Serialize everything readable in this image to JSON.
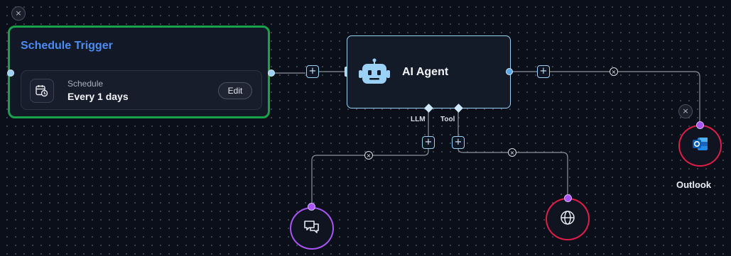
{
  "trigger": {
    "title": "Schedule Trigger",
    "schedule_label": "Schedule",
    "schedule_value": "Every 1 days",
    "edit_label": "Edit",
    "border_color": "#16a34a",
    "title_color": "#4b8cf5"
  },
  "agent": {
    "title": "AI Agent",
    "llm_label": "LLM",
    "tool_label": "Tool"
  },
  "nodes": {
    "outlook_label": "Outlook",
    "chat_icon": "chat-bubbles-icon",
    "web_icon": "globe-icon",
    "outlook_icon": "outlook-icon"
  },
  "controls": {
    "add_symbol": "+",
    "remove_symbol": "×",
    "close_symbol": "×"
  },
  "colors": {
    "wire": "#8d939e",
    "port": "#9ad1f5",
    "accent_purple": "#a855f7",
    "accent_red": "#e11d48"
  }
}
